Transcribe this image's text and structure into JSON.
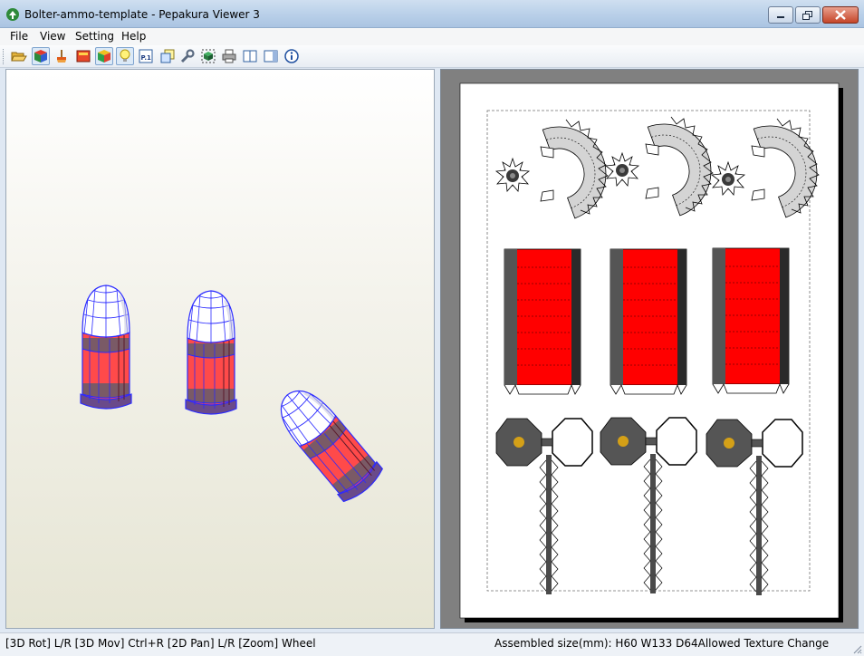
{
  "window": {
    "title": "Bolter-ammo-template - Pepakura Viewer 3",
    "controls": [
      "minimize",
      "maximize",
      "close"
    ]
  },
  "menu": {
    "items": [
      "File",
      "View",
      "Setting",
      "Help"
    ]
  },
  "toolbar": {
    "buttons": [
      {
        "icon": "open-folder-icon"
      },
      {
        "icon": "3d-view-icon",
        "pressed": true
      },
      {
        "icon": "paint-brush-icon"
      },
      {
        "icon": "texture-icon"
      },
      {
        "icon": "color-cube-icon",
        "pressed": true
      },
      {
        "icon": "light-bulb-icon",
        "pressed": true
      },
      {
        "icon": "page-number-icon",
        "label": "P.1"
      },
      {
        "icon": "multiple-pages-icon"
      },
      {
        "icon": "wrench-icon"
      },
      {
        "icon": "cube-select-icon"
      },
      {
        "icon": "printer-icon"
      },
      {
        "icon": "split-view-icon"
      },
      {
        "icon": "single-view-icon"
      },
      {
        "icon": "info-icon"
      }
    ]
  },
  "viewport3d": {
    "background_top": "#ffffff",
    "background_bottom": "#e6e5d4",
    "model_color": "#ff4a4a",
    "edge_color": "#2a2aff"
  },
  "viewport2d": {
    "paper_color": "#ffffff",
    "background": "#808080",
    "part_colors": {
      "red": "#ff0000",
      "dark": "#555555",
      "gray": "#cfcfcf",
      "gold": "#d4a017"
    }
  },
  "status": {
    "left": "[3D Rot] L/R [3D Mov] Ctrl+R [2D Pan] L/R [Zoom] Wheel",
    "right": "Assembled size(mm): H60 W133 D64Allowed Texture Change"
  }
}
